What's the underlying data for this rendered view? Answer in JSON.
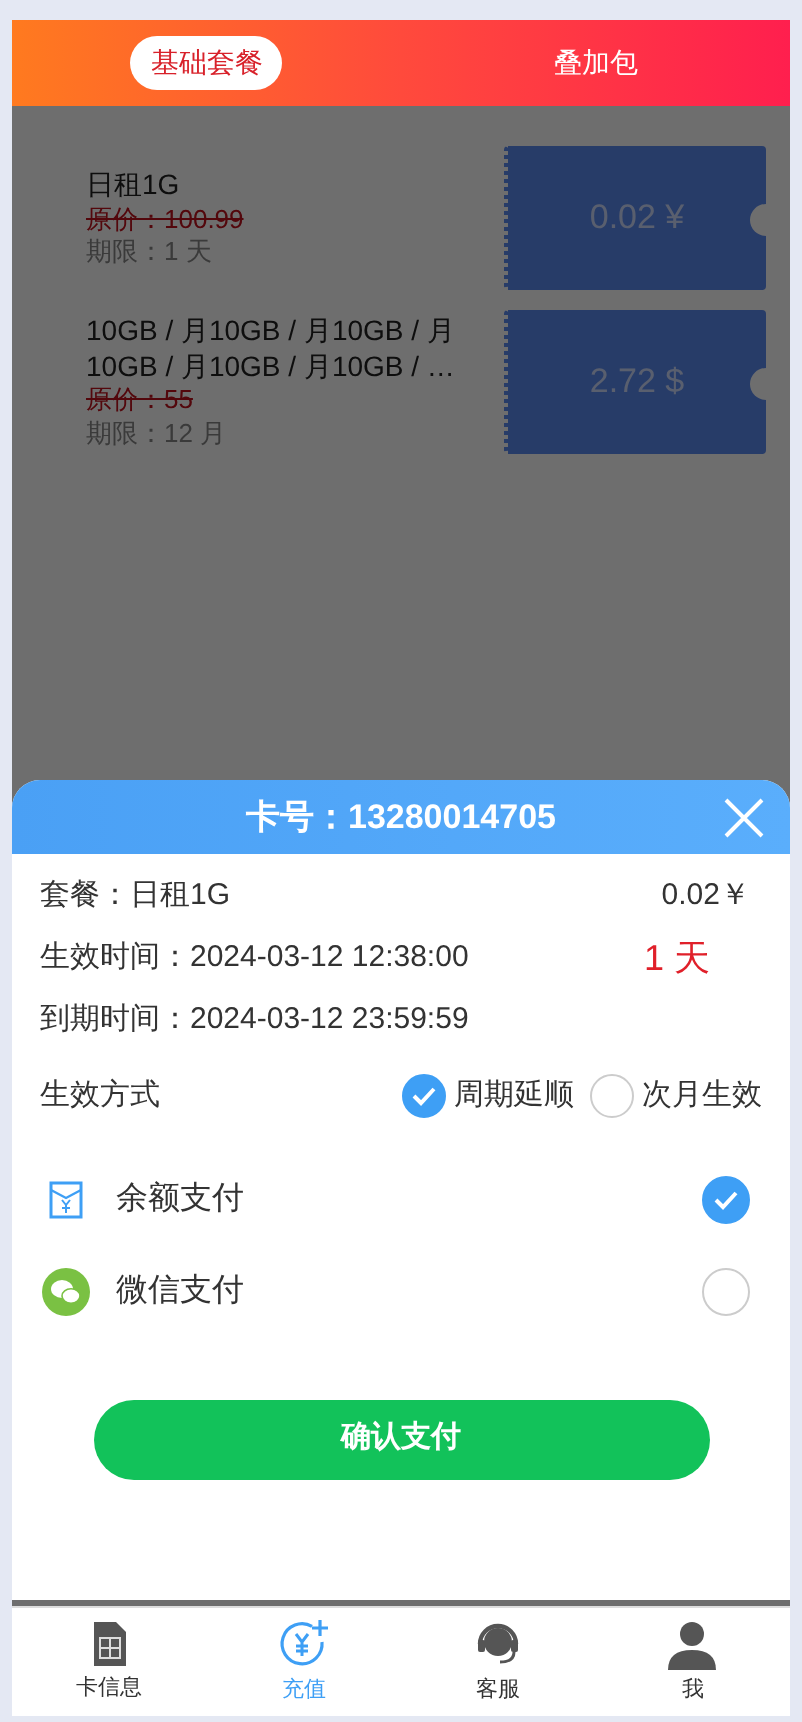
{
  "tabs": [
    {
      "label": "基础套餐",
      "selected": true
    },
    {
      "label": "叠加包",
      "selected": false
    }
  ],
  "packages": [
    {
      "name": "日租1G",
      "original_price": "原价：100.99",
      "period": "期限：1 天",
      "price": "0.02 ¥"
    },
    {
      "name": "10GB / 月10GB / 月10GB / 月10GB / 月10GB / 月10GB / …",
      "original_price": "原价：55",
      "period": "期限：12 月",
      "price": "2.72 $"
    }
  ],
  "dialog": {
    "title": "卡号：13280014705",
    "plan": "套餐：日租1G",
    "price": "0.02￥",
    "start": "生效时间：2024-03-12 12:38:00",
    "duration": "1 天",
    "end": "到期时间：2024-03-12 23:59:59",
    "mode_label": "生效方式",
    "modes": [
      {
        "label": "周期延顺",
        "selected": true
      },
      {
        "label": "次月生效",
        "selected": false
      }
    ],
    "payments": [
      {
        "kind": "balance",
        "label": "余额支付",
        "selected": true
      },
      {
        "kind": "wechat",
        "label": "微信支付",
        "selected": false
      }
    ],
    "confirm": "确认支付"
  },
  "nav": [
    {
      "kind": "sim",
      "label": "卡信息",
      "selected": false
    },
    {
      "kind": "recharge",
      "label": "充值",
      "selected": true
    },
    {
      "kind": "service",
      "label": "客服",
      "selected": false
    },
    {
      "kind": "user",
      "label": "我",
      "selected": false
    }
  ]
}
